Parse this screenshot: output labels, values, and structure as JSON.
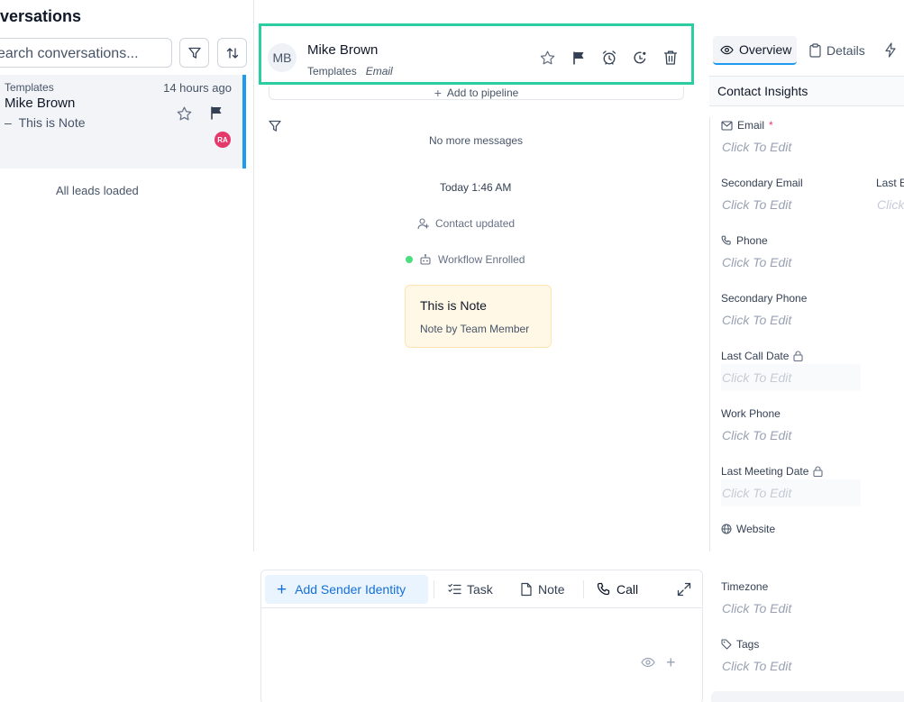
{
  "left_panel": {
    "title": "versations",
    "search_placeholder": "earch conversations...",
    "conversation": {
      "source": "Templates",
      "time": "14 hours ago",
      "name": "Mike Brown",
      "preview": "This is Note",
      "assignee_initials": "RA"
    },
    "all_loaded": "All leads loaded"
  },
  "header": {
    "initials": "MB",
    "name": "Mike Brown",
    "source": "Templates",
    "channel": "Email",
    "pipeline_label": "Add to pipeline"
  },
  "timeline": {
    "no_more": "No more messages",
    "date": "Today 1:46 AM",
    "contact_updated": "Contact updated",
    "workflow": "Workflow Enrolled",
    "note_title": "This is Note",
    "note_by": "Note by Team Member"
  },
  "composer": {
    "sender_identity": "Add Sender Identity",
    "task": "Task",
    "note": "Note",
    "call": "Call"
  },
  "right_panel": {
    "tab_overview": "Overview",
    "tab_details": "Details",
    "section_title": "Contact Insights",
    "click_to_edit": "Click To Edit",
    "fields": {
      "email": "Email",
      "secondary_email": "Secondary Email",
      "last_email": "Last E",
      "last_email_value": "Click",
      "phone": "Phone",
      "secondary_phone": "Secondary Phone",
      "last_call_date": "Last Call Date",
      "work_phone": "Work Phone",
      "last_meeting_date": "Last Meeting Date",
      "website": "Website",
      "timezone": "Timezone",
      "tags": "Tags"
    }
  },
  "colors": {
    "accent": "#1d9bf0",
    "highlight_border": "#2ccea1",
    "note_bg": "#fff8e6",
    "status_green": "#4ade80",
    "avatar_pink": "#e5396b"
  }
}
